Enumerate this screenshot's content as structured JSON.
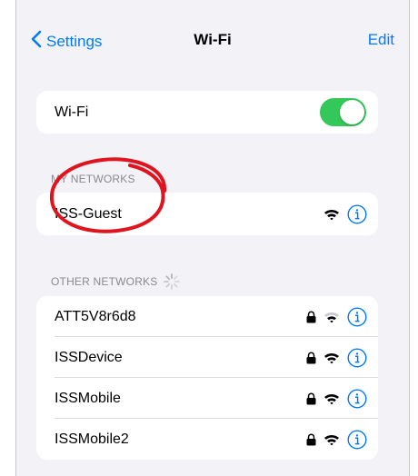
{
  "nav": {
    "back_label": "Settings",
    "title": "Wi-Fi",
    "edit_label": "Edit"
  },
  "wifi_toggle": {
    "label": "Wi-Fi",
    "on": true
  },
  "my_networks": {
    "header": "MY NETWORKS",
    "items": [
      {
        "name": "ISS-Guest",
        "secured": false
      }
    ]
  },
  "other_networks": {
    "header": "OTHER NETWORKS",
    "items": [
      {
        "name": "ATT5V8r6d8",
        "secured": true
      },
      {
        "name": "ISSDevice",
        "secured": true
      },
      {
        "name": "ISSMobile",
        "secured": true
      },
      {
        "name": "ISSMobile2",
        "secured": true
      }
    ]
  },
  "colors": {
    "accent": "#007aff",
    "toggle_on": "#34c759",
    "annotation": "#e0141e"
  },
  "icons": [
    "chevron-left-icon",
    "lock-icon",
    "wifi-icon",
    "info-icon",
    "spinner-icon"
  ]
}
